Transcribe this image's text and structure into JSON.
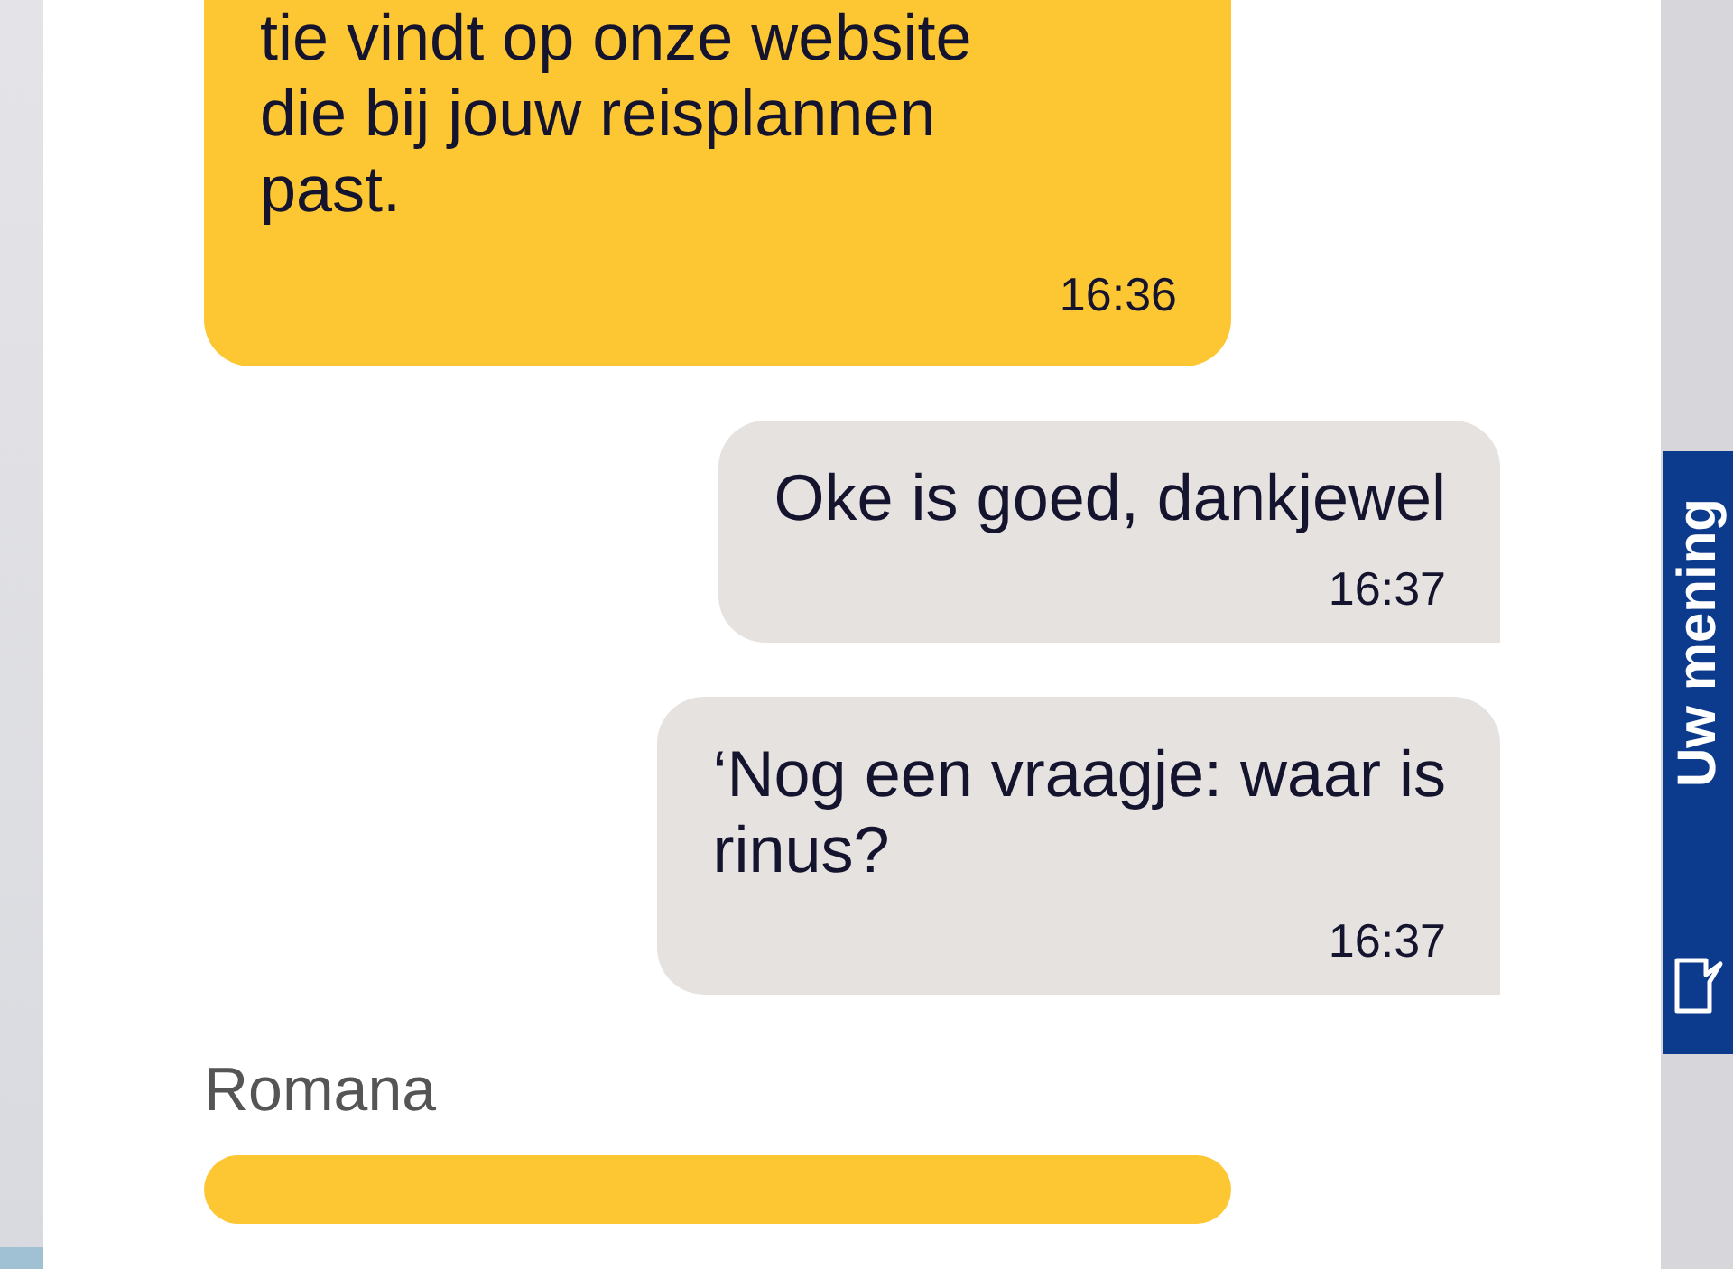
{
  "messages": [
    {
      "kind": "agent",
      "lines": [
        "tie vindt op onze website",
        "die bij jouw reisplannen",
        "past."
      ],
      "time": "16:36"
    },
    {
      "kind": "user",
      "lines": [
        "Oke is goed, dankjewel"
      ],
      "time": "16:37"
    },
    {
      "kind": "user",
      "lines": [
        "‘Nog een vraagje: waar is",
        "rinus?"
      ],
      "time": "16:37"
    },
    {
      "kind": "sender",
      "name": "Romana"
    },
    {
      "kind": "agent"
    }
  ],
  "feedback_tab": {
    "label": "Uw mening"
  }
}
